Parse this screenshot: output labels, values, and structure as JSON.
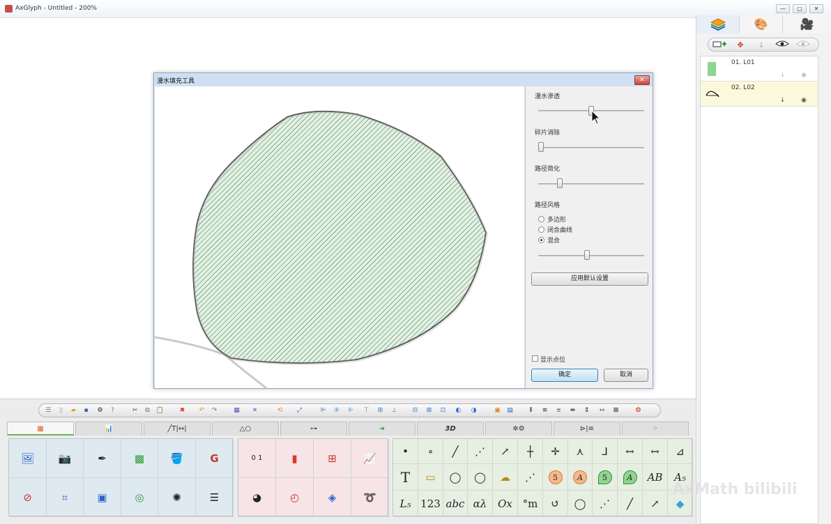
{
  "window": {
    "title": "AxGlyph - Untitled - 200%",
    "min_label": "—",
    "max_label": "▢",
    "close_label": "✕"
  },
  "right_panel": {
    "tabs": [
      "layers",
      "palette",
      "camera"
    ],
    "layers": [
      {
        "name": "01. L01",
        "thumb_color": "#8fd48f",
        "visible": false
      },
      {
        "name": "02. L02",
        "thumb_color": "#ffffff",
        "visible": true
      }
    ]
  },
  "dialog": {
    "title": "漫水填充工具",
    "close_label": "✕",
    "groups": [
      {
        "label": "漫水渗透",
        "slider_value": 0.5
      },
      {
        "label": "碎片消除",
        "slider_value": 0.0
      },
      {
        "label": "路径简化",
        "slider_value": 0.2
      }
    ],
    "style_group": {
      "label": "路径风格",
      "options": [
        "多边形",
        "闭合曲线",
        "混合"
      ],
      "selected": 2,
      "slider_value": 0.45
    },
    "apply_default_label": "应用默认设置",
    "show_points_label": "显示点位",
    "ok_label": "确定",
    "cancel_label": "取消",
    "fill_color": "#e3f1e4",
    "hatch_color": "#2f6f3a"
  },
  "bottom": {
    "tabs": [
      "",
      "",
      "╱T|↔|",
      "△○",
      "",
      "➜",
      "3D",
      "",
      "",
      ""
    ],
    "symbols": [
      [
        "•",
        "∘",
        "╱",
        "⋰",
        "↗",
        "┼",
        "✛",
        "⋏",
        "⅃",
        "↔",
        "↔",
        "⊿"
      ],
      [
        "T",
        "▭",
        "◯",
        "◯",
        "☁",
        "⋰",
        "5",
        "A",
        "5",
        "A",
        "AB",
        "A₅"
      ],
      [
        "L₅",
        "123",
        "abc",
        "αλ",
        "Ox",
        "°m",
        "↺",
        "◯",
        "⋰",
        "╱",
        "↗",
        "◆"
      ]
    ]
  },
  "watermark": "AxMath bilibili"
}
